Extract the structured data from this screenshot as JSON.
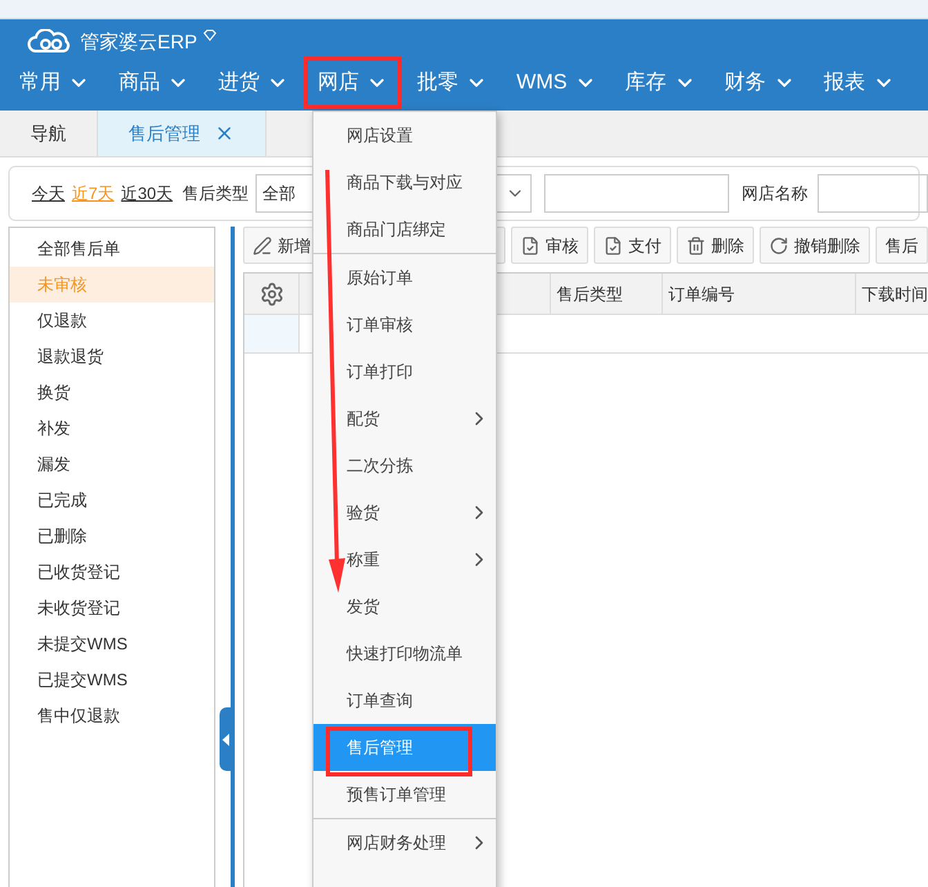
{
  "header": {
    "logo_text": "管家婆云ERP"
  },
  "nav": [
    {
      "label": "常用",
      "highlighted": false
    },
    {
      "label": "商品",
      "highlighted": false
    },
    {
      "label": "进货",
      "highlighted": false
    },
    {
      "label": "网店",
      "highlighted": true
    },
    {
      "label": "批零",
      "highlighted": false
    },
    {
      "label": "WMS",
      "highlighted": false
    },
    {
      "label": "库存",
      "highlighted": false
    },
    {
      "label": "财务",
      "highlighted": false
    },
    {
      "label": "报表",
      "highlighted": false
    }
  ],
  "tabs": [
    {
      "label": "导航",
      "selected": false,
      "closable": false
    },
    {
      "label": "售后管理",
      "selected": true,
      "closable": true
    }
  ],
  "filter": {
    "dates": [
      {
        "label": "今天",
        "selected": false
      },
      {
        "label": "近7天",
        "selected": true
      },
      {
        "label": "近30天",
        "selected": false
      }
    ],
    "type_label": "售后类型",
    "type_value": "全部",
    "shop_label": "网店名称"
  },
  "sidebar": [
    {
      "label": "全部售后单",
      "selected": false
    },
    {
      "label": "未审核",
      "selected": true
    },
    {
      "label": "仅退款",
      "selected": false
    },
    {
      "label": "退款退货",
      "selected": false
    },
    {
      "label": "换货",
      "selected": false
    },
    {
      "label": "补发",
      "selected": false
    },
    {
      "label": "漏发",
      "selected": false
    },
    {
      "label": "已完成",
      "selected": false
    },
    {
      "label": "已删除",
      "selected": false
    },
    {
      "label": "已收货登记",
      "selected": false
    },
    {
      "label": "未收货登记",
      "selected": false
    },
    {
      "label": "未提交WMS",
      "selected": false
    },
    {
      "label": "已提交WMS",
      "selected": false
    },
    {
      "label": "售中仅退款",
      "selected": false
    }
  ],
  "toolbar": [
    {
      "label": "新增",
      "kind": "edit"
    },
    {
      "label": "审核",
      "kind": "check"
    },
    {
      "label": "支付",
      "kind": "check"
    },
    {
      "label": "删除",
      "kind": "trash"
    },
    {
      "label": "撤销删除",
      "kind": "undo"
    },
    {
      "label": "售后",
      "kind": "plain"
    }
  ],
  "table": {
    "columns": [
      "售后类型",
      "订单编号",
      "下载时间"
    ]
  },
  "menu": {
    "groups": [
      [
        {
          "label": "网店设置",
          "submenu": false,
          "selected": false
        },
        {
          "label": "商品下载与对应",
          "submenu": false,
          "selected": false
        },
        {
          "label": "商品门店绑定",
          "submenu": false,
          "selected": false
        }
      ],
      [
        {
          "label": "原始订单",
          "submenu": false,
          "selected": false
        },
        {
          "label": "订单审核",
          "submenu": false,
          "selected": false
        },
        {
          "label": "订单打印",
          "submenu": false,
          "selected": false
        },
        {
          "label": "配货",
          "submenu": true,
          "selected": false
        },
        {
          "label": "二次分拣",
          "submenu": false,
          "selected": false
        },
        {
          "label": "验货",
          "submenu": true,
          "selected": false
        },
        {
          "label": "称重",
          "submenu": true,
          "selected": false
        },
        {
          "label": "发货",
          "submenu": false,
          "selected": false
        },
        {
          "label": "快速打印物流单",
          "submenu": false,
          "selected": false
        },
        {
          "label": "订单查询",
          "submenu": false,
          "selected": false
        },
        {
          "label": "售后管理",
          "submenu": false,
          "selected": true
        },
        {
          "label": "预售订单管理",
          "submenu": false,
          "selected": false
        }
      ],
      [
        {
          "label": "网店财务处理",
          "submenu": true,
          "selected": false
        }
      ]
    ]
  }
}
